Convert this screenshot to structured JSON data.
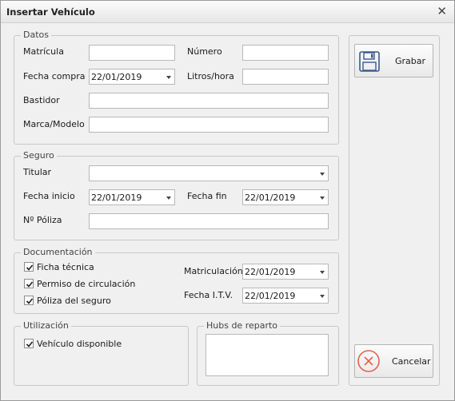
{
  "window": {
    "title": "Insertar Vehículo"
  },
  "datos": {
    "legend": "Datos",
    "matricula_label": "Matrícula",
    "matricula_value": "",
    "numero_label": "Número",
    "numero_value": "",
    "fecha_compra_label": "Fecha compra",
    "fecha_compra_value": "22/01/2019",
    "litros_label": "Litros/hora",
    "litros_value": "",
    "bastidor_label": "Bastidor",
    "bastidor_value": "",
    "marca_label": "Marca/Modelo",
    "marca_value": ""
  },
  "seguro": {
    "legend": "Seguro",
    "titular_label": "Titular",
    "titular_value": "",
    "fecha_inicio_label": "Fecha inicio",
    "fecha_inicio_value": "22/01/2019",
    "fecha_fin_label": "Fecha fin",
    "fecha_fin_value": "22/01/2019",
    "poliza_label": "Nº Póliza",
    "poliza_value": ""
  },
  "documentacion": {
    "legend": "Documentación",
    "checks": [
      {
        "label": "Ficha técnica",
        "checked": true
      },
      {
        "label": "Permiso de circulación",
        "checked": true
      },
      {
        "label": "Póliza del seguro",
        "checked": true
      }
    ],
    "matriculacion_label": "Matriculación",
    "matriculacion_value": "22/01/2019",
    "itv_label": "Fecha I.T.V.",
    "itv_value": "22/01/2019"
  },
  "utilizacion": {
    "legend": "Utilización",
    "disponible_label": "Vehículo disponible",
    "disponible_checked": true
  },
  "hubs": {
    "legend": "Hubs de reparto"
  },
  "buttons": {
    "save_label": "Grabar",
    "cancel_label": "Cancelar"
  },
  "colors": {
    "cancel_icon": "#e8604a",
    "save_icon": "#3a5a8c"
  }
}
